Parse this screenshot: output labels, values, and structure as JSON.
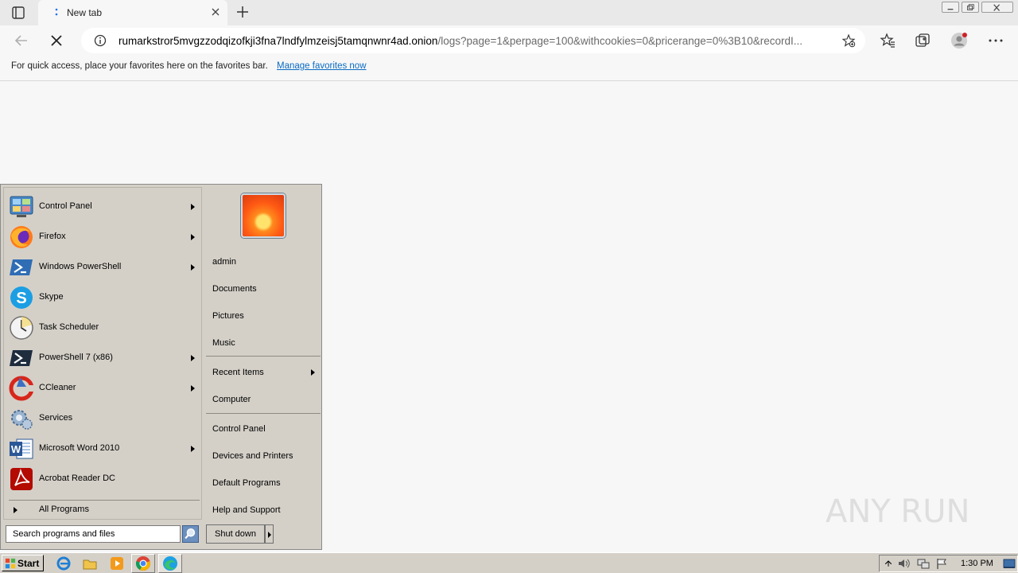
{
  "browser": {
    "tab": {
      "title": "New tab"
    },
    "address": {
      "url_host": "rumarkstror5mvgzzodqizofkji3fna7lndfylmzeisj5tamqnwnr4ad.onion",
      "url_path": "/logs?page=1&perpage=100&withcookies=0&pricerange=0%3B10&recordI..."
    },
    "favorites_bar": {
      "message": "For quick access, place your favorites here on the favorites bar.",
      "link": "Manage favorites now"
    }
  },
  "start_menu": {
    "programs": [
      {
        "label": "Control Panel",
        "icon": "control-panel-icon",
        "submenu": true
      },
      {
        "label": "Firefox",
        "icon": "firefox-icon",
        "submenu": true
      },
      {
        "label": "Windows PowerShell",
        "icon": "powershell-icon",
        "submenu": true
      },
      {
        "label": "Skype",
        "icon": "skype-icon",
        "submenu": false
      },
      {
        "label": "Task Scheduler",
        "icon": "task-scheduler-icon",
        "submenu": false
      },
      {
        "label": "PowerShell 7 (x86)",
        "icon": "powershell7-icon",
        "submenu": true
      },
      {
        "label": "CCleaner",
        "icon": "ccleaner-icon",
        "submenu": true
      },
      {
        "label": "Services",
        "icon": "services-icon",
        "submenu": false
      },
      {
        "label": "Microsoft Word 2010",
        "icon": "word-icon",
        "submenu": true
      },
      {
        "label": "Acrobat Reader DC",
        "icon": "acrobat-icon",
        "submenu": false
      }
    ],
    "all_programs": "All Programs",
    "search_placeholder": "Search programs and files",
    "right_links": {
      "user": "admin",
      "documents": "Documents",
      "pictures": "Pictures",
      "music": "Music",
      "recent_items": "Recent Items",
      "computer": "Computer",
      "control_panel": "Control Panel",
      "devices_printers": "Devices and Printers",
      "default_programs": "Default Programs",
      "help_support": "Help and Support"
    },
    "shutdown": "Shut down"
  },
  "taskbar": {
    "start_label": "Start",
    "clock": "1:30 PM"
  },
  "watermark": "ANY RUN"
}
